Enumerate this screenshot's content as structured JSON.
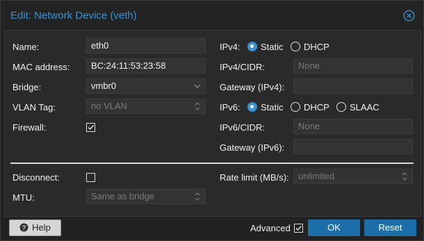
{
  "dialog": {
    "title": "Edit: Network Device (veth)",
    "close_icon": "close-circle-icon"
  },
  "left": {
    "name": {
      "label": "Name:",
      "value": "eth0"
    },
    "mac": {
      "label": "MAC address:",
      "value": "BC:24:11:53:23:58"
    },
    "bridge": {
      "label": "Bridge:",
      "value": "vmbr0"
    },
    "vlan": {
      "label": "VLAN Tag:",
      "placeholder": "no VLAN"
    },
    "firewall": {
      "label": "Firewall:",
      "checked": true
    }
  },
  "right": {
    "ipv4": {
      "label": "IPv4:",
      "options": [
        "Static",
        "DHCP"
      ],
      "selected": "Static"
    },
    "ipv4_cidr": {
      "label": "IPv4/CIDR:",
      "placeholder": "None"
    },
    "gateway4": {
      "label": "Gateway (IPv4):",
      "value": ""
    },
    "ipv6": {
      "label": "IPv6:",
      "options": [
        "Static",
        "DHCP",
        "SLAAC"
      ],
      "selected": "Static"
    },
    "ipv6_cidr": {
      "label": "IPv6/CIDR:",
      "placeholder": "None"
    },
    "gateway6": {
      "label": "Gateway (IPv6):",
      "value": ""
    }
  },
  "advanced": {
    "disconnect": {
      "label": "Disconnect:",
      "checked": false
    },
    "mtu": {
      "label": "MTU:",
      "placeholder": "Same as bridge"
    },
    "rate": {
      "label": "Rate limit (MB/s):",
      "placeholder": "unlimited"
    }
  },
  "footer": {
    "help_label": "Help",
    "advanced_label": "Advanced",
    "advanced_checked": true,
    "ok_label": "OK",
    "reset_label": "Reset"
  },
  "colors": {
    "accent": "#3892d4",
    "primary_button": "#1b6ea8",
    "background": "#222222",
    "panel": "#2a2a2a"
  }
}
